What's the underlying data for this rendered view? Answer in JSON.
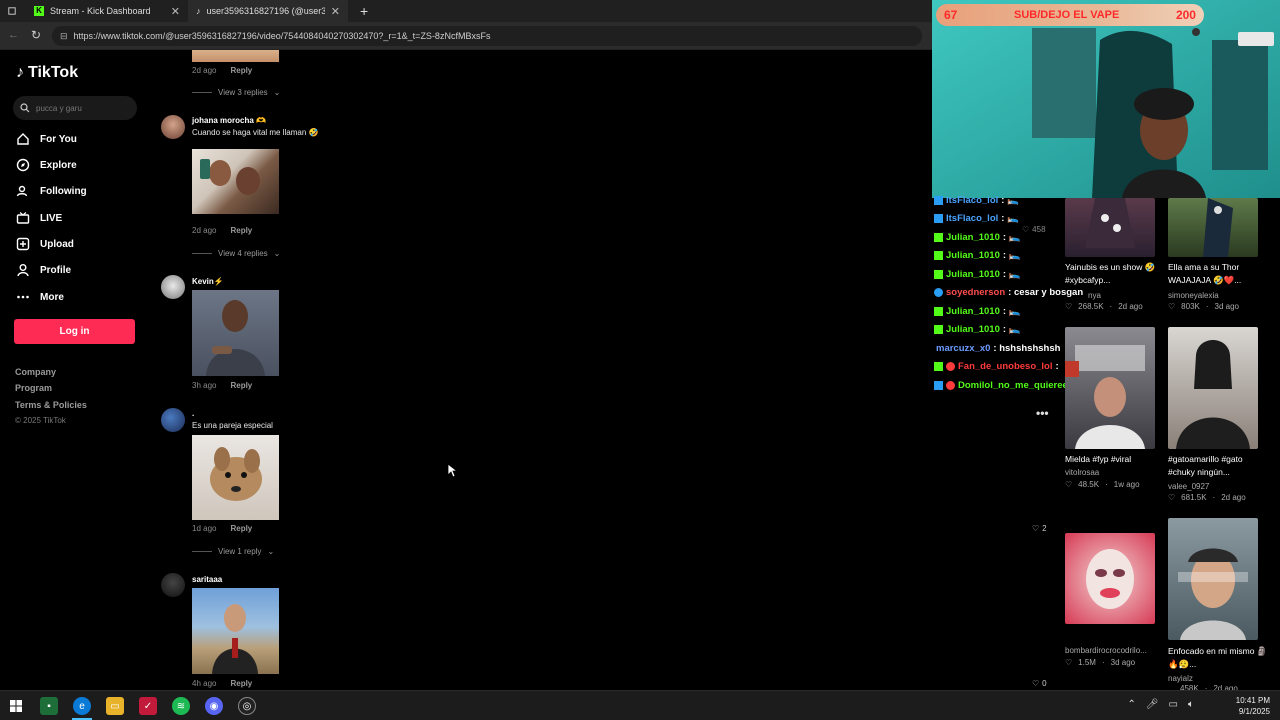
{
  "browser": {
    "tabs": [
      {
        "label": "Stream - Kick Dashboard"
      },
      {
        "label": "user3596316827196 (@user35963..."
      }
    ],
    "url": "https://www.tiktok.com/@user3596316827196/video/7544084040270302470?_r=1&_t=ZS-8zNcfMBxsFs"
  },
  "sidebar": {
    "logo": "TikTok",
    "search_placeholder": "pucca y garu",
    "items": [
      {
        "label": "For You",
        "icon": "home-icon"
      },
      {
        "label": "Explore",
        "icon": "compass-icon"
      },
      {
        "label": "Following",
        "icon": "following-icon"
      },
      {
        "label": "LIVE",
        "icon": "live-icon"
      },
      {
        "label": "Upload",
        "icon": "upload-icon"
      },
      {
        "label": "Profile",
        "icon": "profile-icon"
      },
      {
        "label": "More",
        "icon": "more-icon"
      }
    ],
    "login": "Log in",
    "footer": [
      "Company",
      "Program",
      "Terms & Policies"
    ],
    "copyright": "© 2025 TikTok"
  },
  "comments": {
    "top_meta": {
      "time": "2d ago",
      "reply": "Reply"
    },
    "top_replies": "View 3 replies",
    "items": [
      {
        "name": "johana morocha 🫶",
        "text": "Cuando se haga vital me llaman 🤣",
        "time": "2d ago",
        "reply": "Reply",
        "replies": "View 4 replies"
      },
      {
        "name": "Kevin⚡",
        "text": "",
        "time": "3h ago",
        "reply": "Reply",
        "replies": ""
      },
      {
        "name": ".",
        "text": "Es una pareja especial",
        "time": "1d ago",
        "reply": "Reply",
        "replies": "View 1 reply"
      },
      {
        "name": "saritaaa",
        "text": "",
        "time": "4h ago",
        "reply": "Reply",
        "replies": ""
      }
    ]
  },
  "stream": {
    "banner_left": "67",
    "banner_text": "SUB/DEJO EL VAPE",
    "banner_right": "200",
    "chat": [
      {
        "user": "ItsFlaco_lol",
        "msg": ": 🛌",
        "color": "#4aa3ff"
      },
      {
        "user": "ItsFlaco_lol",
        "msg": ": 🛌",
        "color": "#4aa3ff"
      },
      {
        "user": "Julian_1010",
        "msg": ": 🛌",
        "color": "#53fc18"
      },
      {
        "user": "Julian_1010",
        "msg": ": 🛌",
        "color": "#53fc18"
      },
      {
        "user": "Julian_1010",
        "msg": ": 🛌",
        "color": "#53fc18"
      },
      {
        "user": "soyednerson",
        "msg": ": cesar y bosgan",
        "color": "#ff4d4d"
      },
      {
        "user": "Julian_1010",
        "msg": ": 🛌",
        "color": "#53fc18"
      },
      {
        "user": "Julian_1010",
        "msg": ": 🛌",
        "color": "#53fc18"
      },
      {
        "user": "marcuzx_x0",
        "msg": ": hshshshshsh",
        "color": "#6b9bff"
      },
      {
        "user": "Fan_de_unobeso_lol",
        "msg": ":",
        "color": "#ff3b3b"
      },
      {
        "user": "Domilol_no_me_quieree",
        "msg": ": 🛌",
        "color": "#53fc18"
      }
    ],
    "side_counts": {
      "first": "458",
      "second": "2",
      "third": "0"
    }
  },
  "videos": [
    {
      "title": "Yainubis es un show 🤣 #xybcafyp...",
      "user": "nya",
      "likes": "268.5K",
      "age": "2d ago"
    },
    {
      "title": "Ella ama a su Thor WAJAJAJA 🤣❤️...",
      "user": "simoneyalexia",
      "likes": "803K",
      "age": "3d ago"
    },
    {
      "title": "Mielda #fyp #viral",
      "user": "vitolrosaa",
      "likes": "48.5K",
      "age": "1w ago"
    },
    {
      "title": "#gatoamarillo #gato #chuky ningún...",
      "user": "valee_0927",
      "likes": "681.5K",
      "age": "2d ago"
    },
    {
      "title": "",
      "user": "bombardirocrocodrilo...",
      "likes": "1.5M",
      "age": "3d ago"
    },
    {
      "title": "Enfocado en mi mismo 🗿🔥😮‍💨...",
      "user": "nayialz",
      "likes": "458K",
      "age": "2d ago"
    }
  ],
  "taskbar": {
    "time": "10:41 PM",
    "date": "9/1/2025"
  }
}
